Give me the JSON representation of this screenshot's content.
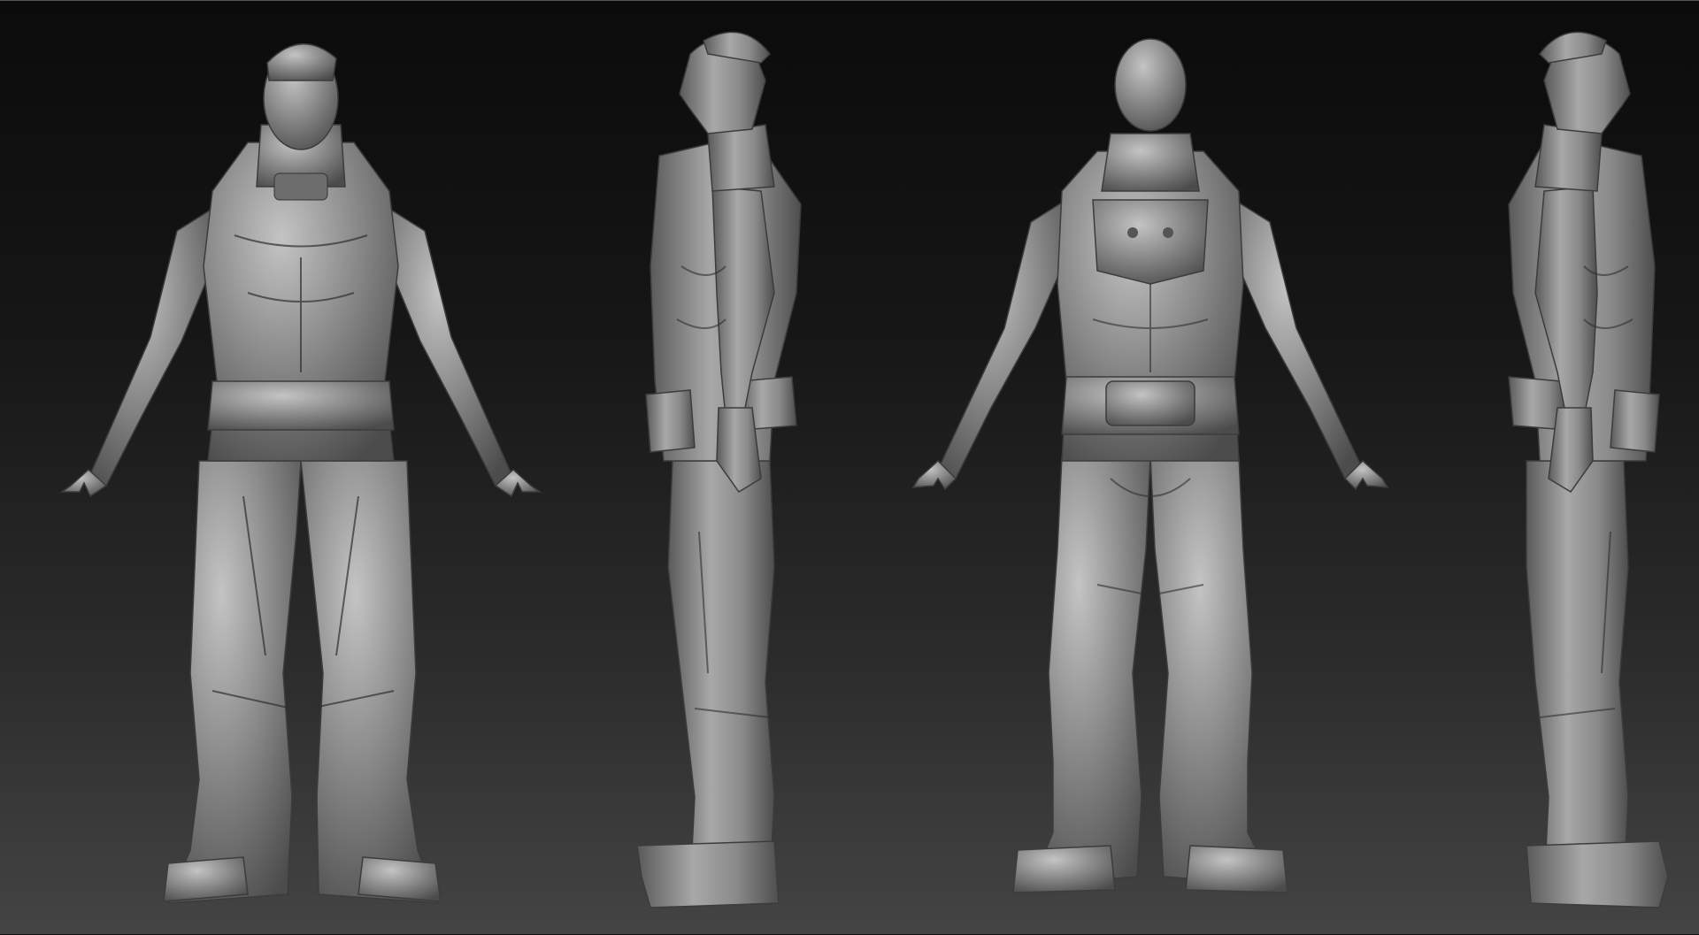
{
  "scene": {
    "background_top": "#0b0b0b",
    "background_bottom": "#444444",
    "clay_color": "#8a8a8a",
    "clay_highlight": "#b9b9b9",
    "clay_shadow": "#4a4a4a"
  },
  "views": [
    {
      "id": "front",
      "icon": "front-view-figure"
    },
    {
      "id": "side-left",
      "icon": "side-view-figure"
    },
    {
      "id": "back",
      "icon": "back-view-figure"
    },
    {
      "id": "side-right",
      "icon": "side-view-figure"
    }
  ]
}
